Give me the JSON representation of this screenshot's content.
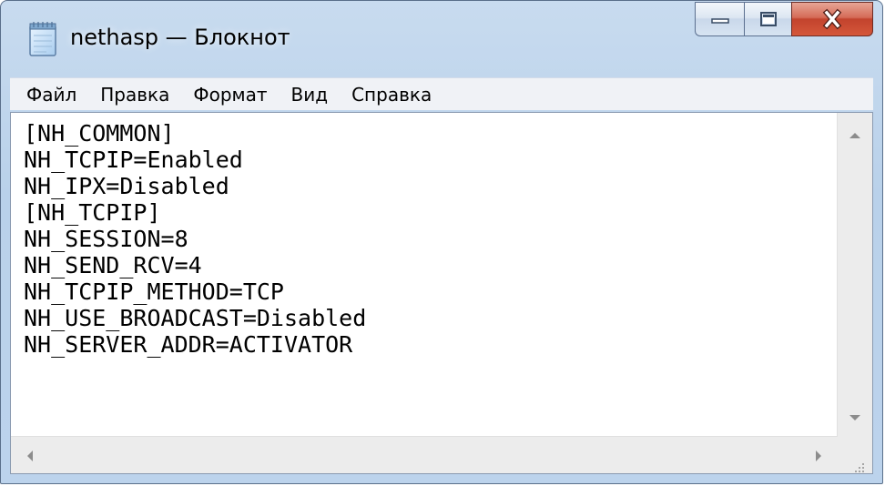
{
  "window": {
    "title": "nethasp — Блокнот",
    "app_icon": "notepad-icon"
  },
  "controls": {
    "minimize_icon": "minimize-icon",
    "maximize_icon": "maximize-icon",
    "close_icon": "close-icon",
    "close_color": "#c7432c"
  },
  "menu": {
    "items": [
      {
        "label": "Файл"
      },
      {
        "label": "Правка"
      },
      {
        "label": "Формат"
      },
      {
        "label": "Вид"
      },
      {
        "label": "Справка"
      }
    ]
  },
  "editor": {
    "lines": [
      "[NH_COMMON]",
      "NH_TCPIP=Enabled",
      "NH_IPX=Disabled",
      "[NH_TCPIP]",
      "NH_SESSION=8",
      "NH_SEND_RCV=4",
      "NH_TCPIP_METHOD=TCP",
      "NH_USE_BROADCAST=Disabled",
      "NH_SERVER_ADDR=ACTIVATOR"
    ]
  },
  "scrollbars": {
    "up_icon": "arrow-up-icon",
    "down_icon": "arrow-down-icon",
    "left_icon": "arrow-left-icon",
    "right_icon": "arrow-right-icon",
    "grip_icon": "resize-grip-icon"
  }
}
